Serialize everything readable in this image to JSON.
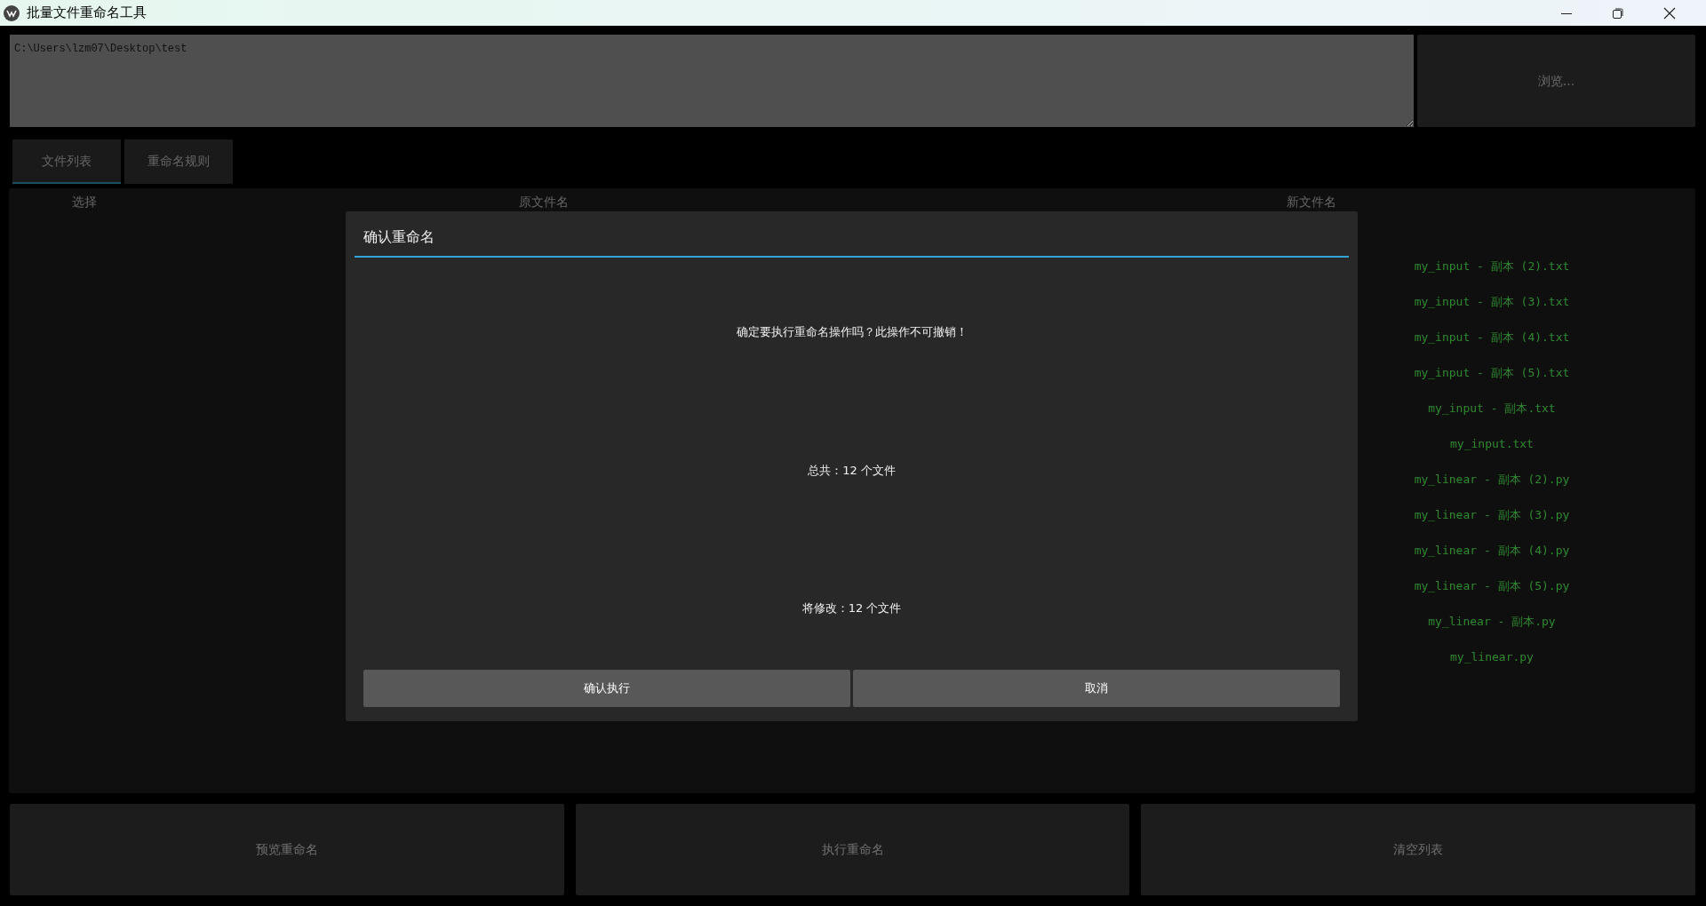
{
  "window": {
    "title": "批量文件重命名工具"
  },
  "path_field": {
    "value": "C:\\Users\\lzm07\\Desktop\\test"
  },
  "browse_button": "浏览...",
  "tabs": [
    {
      "label": "文件列表",
      "selected": true
    },
    {
      "label": "重命名规则",
      "selected": false
    }
  ],
  "table": {
    "columns": [
      "选择",
      "原文件名",
      "新文件名"
    ],
    "rows": [
      {
        "new_name": "my_input - 副本 (2).txt"
      },
      {
        "new_name": "my_input - 副本 (3).txt"
      },
      {
        "new_name": "my_input - 副本 (4).txt"
      },
      {
        "new_name": "my_input - 副本 (5).txt"
      },
      {
        "new_name": "my_input - 副本.txt"
      },
      {
        "new_name": "my_input.txt"
      },
      {
        "new_name": "my_linear - 副本 (2).py"
      },
      {
        "new_name": "my_linear - 副本 (3).py"
      },
      {
        "new_name": "my_linear - 副本 (4).py"
      },
      {
        "new_name": "my_linear - 副本 (5).py"
      },
      {
        "new_name": "my_linear - 副本.py"
      },
      {
        "new_name": "my_linear.py"
      }
    ]
  },
  "dialog": {
    "title": "确认重命名",
    "message": "确定要执行重命名操作吗？此操作不可撤销！",
    "total": "总共：12 个文件",
    "modified": "将修改：12 个文件",
    "buttons": [
      "确认执行",
      "取消"
    ]
  },
  "actions": [
    "预览重命名",
    "执行重命名",
    "清空列表"
  ]
}
